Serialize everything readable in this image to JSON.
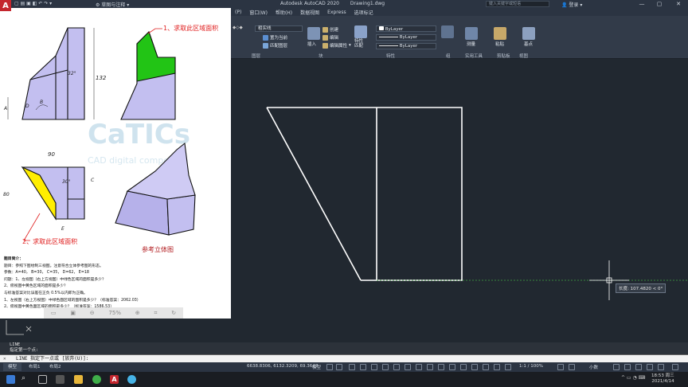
{
  "window": {
    "app_logo": "A",
    "title_app": "Autodesk AutoCAD 2020",
    "title_file": "Drawing1.dwg",
    "search_placeholder": "键入关键字或短语",
    "user": "登录",
    "workspace": "草图与注释"
  },
  "menu": [
    "(P)",
    "窗口(W)",
    "帮助(H)",
    "数据视图",
    "Express",
    "选项标记"
  ],
  "ribbon": {
    "layer_dd": "粗实线",
    "buttons": {
      "set_current": "置为当前",
      "match_layer": "匹配图层",
      "create": "创建",
      "edit": "编辑",
      "edit_attr": "编辑属性",
      "insert": "插入",
      "match_props": "特性匹配",
      "measure": "测量",
      "paste": "粘贴",
      "base": "基点",
      "group": "组"
    },
    "props": [
      "ByLayer",
      "ByLayer",
      "ByLayer"
    ],
    "panels": [
      "图层",
      "块",
      "特性",
      "组",
      "实用工具",
      "剪贴板",
      "视图"
    ]
  },
  "doc": {
    "label1": "1、求取此区域面积",
    "label2": "2、求取此区域面积",
    "ref_label": "参考立体图",
    "dim_90": "90",
    "dim_132": "132",
    "dim_32": "32°",
    "dim_B": "B",
    "dim_A": "A",
    "dim_D": "D",
    "dim_C": "C",
    "dim_E": "E",
    "dim_80": "80",
    "dim_30": "30°",
    "watermark": "CaTICs",
    "watermark_sub": "CAD digital compe...on",
    "text_lines": [
      "题目简介：",
      "题目：参照下图绘制三视图。注意符合立体参考图的形态。",
      "参数：A=40， B=30， C=35， D=62， E=18",
      "问题：1、左视图（右上方视图）中绿色区域的面积是多少？",
      "2、俯视图中黄色区域的面积是多少？",
      "与标准答案对比误差在正负 0.5%以内即为正确。",
      "1、左视图（右上方视图）中绿色面区域的面积是多少？（标准答案：2062.03）",
      "2、俯视图中黄色面区域的面积是多少？（标准答案：1586.53）"
    ],
    "zoom": "75%"
  },
  "canvas": {
    "tooltip_label": "长度",
    "tooltip_value": "107.4820 < 0°"
  },
  "command": {
    "history": [
      "LINE",
      "指定第一个点:"
    ],
    "prompt": "LINE 指定下一点或 [放弃(U)]:"
  },
  "status": {
    "tabs": [
      "模型",
      "布局1",
      "布局2"
    ],
    "coords": "6638.8306, 6132.3209, 69.3647",
    "mode": "模型",
    "scale": "1:1 / 100%",
    "units": "小数"
  },
  "taskbar": {
    "time": "18:53 周三",
    "date": "2021/4/14"
  },
  "colors": {
    "green": "#22c415",
    "yellow": "#ffee00",
    "violet": "#c3bff0",
    "red": "#e02020"
  }
}
